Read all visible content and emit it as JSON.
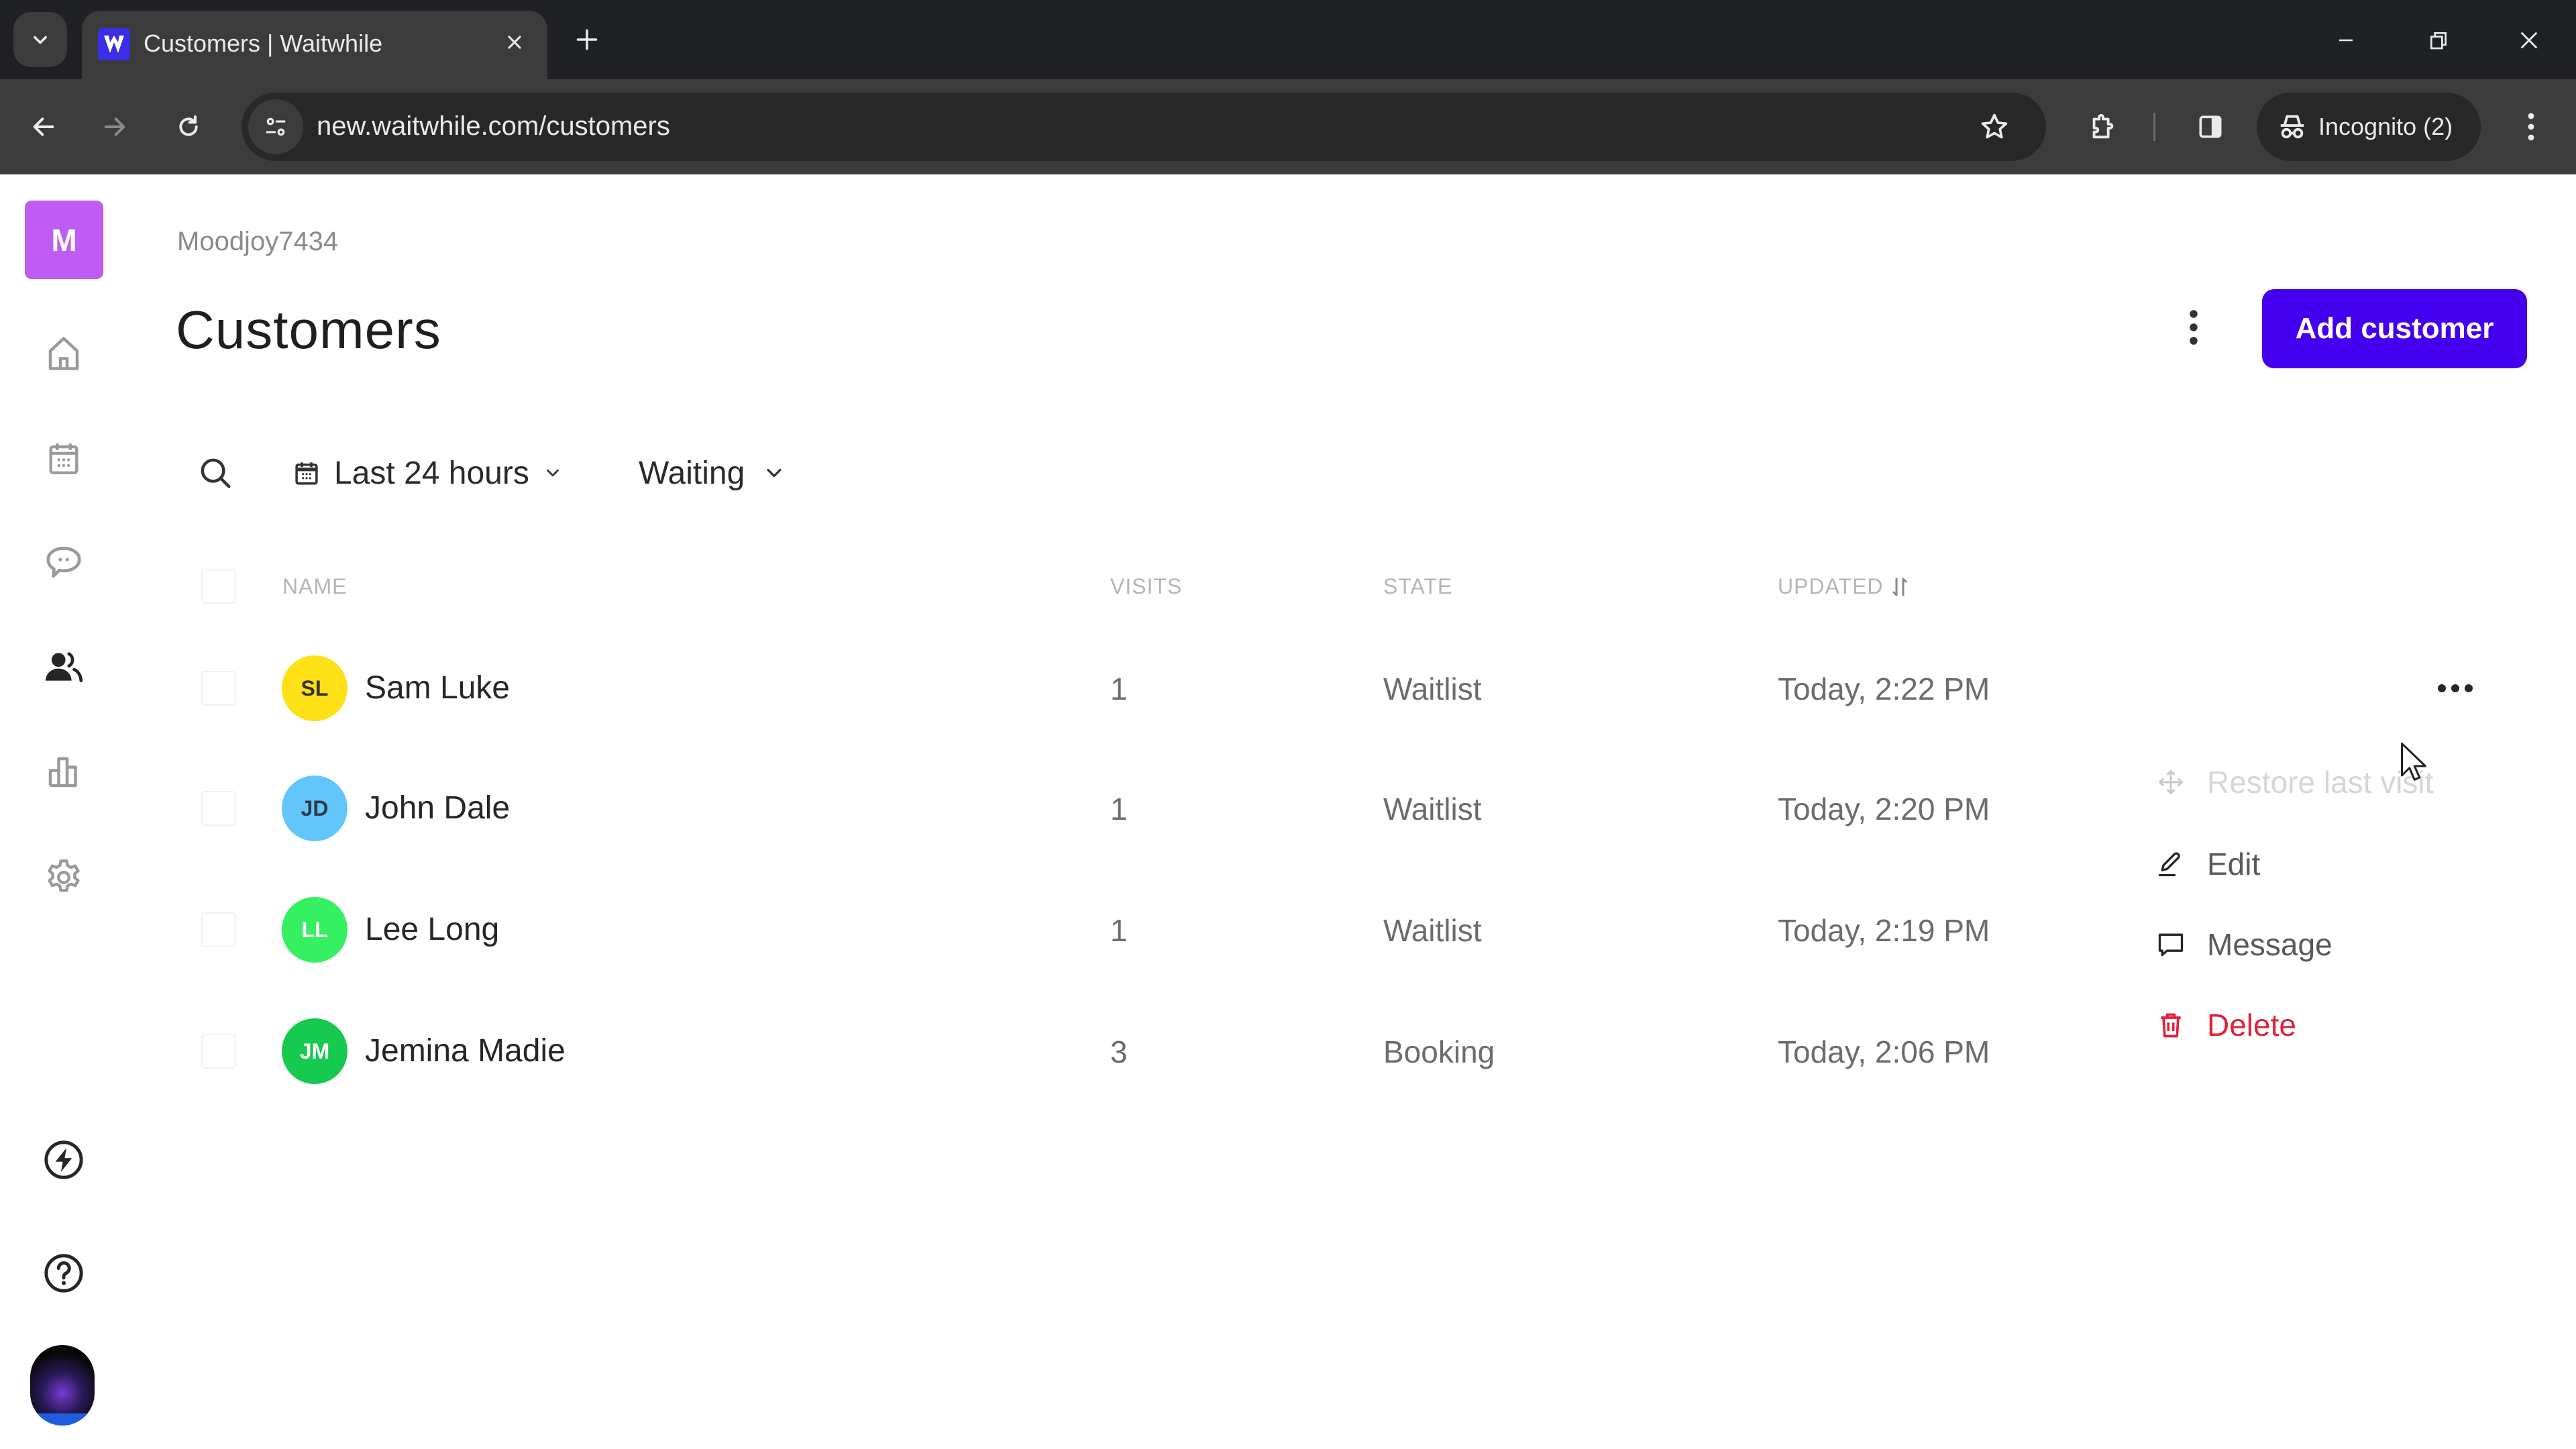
{
  "browser": {
    "tab_title": "Customers | Waitwhile",
    "favicon_letter": "W",
    "url": "new.waitwhile.com/customers",
    "incognito_label": "Incognito (2)",
    "icons": {
      "tab_search": "chevron-down-icon",
      "close_tab": "close-icon",
      "new_tab": "plus-icon",
      "minimize": "minimize-icon",
      "restore": "restore-window-icon",
      "close_window": "close-icon",
      "back": "arrow-left-icon",
      "forward": "arrow-right-icon",
      "reload": "reload-icon",
      "site_info": "tune-icon",
      "bookmark": "star-icon",
      "extensions": "puzzle-icon",
      "side_panel": "side-panel-icon",
      "incognito": "incognito-icon",
      "menu": "kebab-icon"
    }
  },
  "sidebar": {
    "org_initial": "M",
    "org_color": "#c05cf5",
    "items": [
      {
        "name": "home",
        "icon": "home-icon",
        "active": false
      },
      {
        "name": "calendar",
        "icon": "calendar-icon",
        "active": false
      },
      {
        "name": "messages",
        "icon": "chat-icon",
        "active": false
      },
      {
        "name": "customers",
        "icon": "users-icon",
        "active": true
      },
      {
        "name": "analytics",
        "icon": "bar-chart-icon",
        "active": false
      },
      {
        "name": "settings",
        "icon": "gear-icon",
        "active": false
      }
    ],
    "bottom_items": [
      {
        "name": "whats-new",
        "icon": "lightning-icon"
      },
      {
        "name": "help",
        "icon": "help-icon"
      },
      {
        "name": "profile",
        "icon": "user-avatar"
      }
    ]
  },
  "header": {
    "org_name": "Moodjoy7434",
    "title": "Customers",
    "add_button_label": "Add customer",
    "accent_color": "#4400ee"
  },
  "filters": {
    "date_range": "Last 24 hours",
    "state": "Waiting"
  },
  "table": {
    "columns": [
      "NAME",
      "VISITS",
      "STATE",
      "UPDATED"
    ],
    "sort_column": "UPDATED",
    "rows": [
      {
        "initials": "SL",
        "name": "Sam Luke",
        "visits": "1",
        "state": "Waitlist",
        "updated": "Today, 2:22 PM",
        "avatar_color": "#fde015",
        "initials_color": "#333333"
      },
      {
        "initials": "JD",
        "name": "John Dale",
        "visits": "1",
        "state": "Waitlist",
        "updated": "Today, 2:20 PM",
        "avatar_color": "#63c6fb",
        "initials_color": "#2b3a4a"
      },
      {
        "initials": "LL",
        "name": "Lee Long",
        "visits": "1",
        "state": "Waitlist",
        "updated": "Today, 2:19 PM",
        "avatar_color": "#35f060",
        "initials_color": "#ffffff"
      },
      {
        "initials": "JM",
        "name": "Jemina Madie",
        "visits": "3",
        "state": "Booking",
        "updated": "Today, 2:06 PM",
        "avatar_color": "#16c94f",
        "initials_color": "#ffffff"
      }
    ]
  },
  "row_menu": {
    "items": [
      {
        "label": "Restore last visit",
        "icon": "move-icon",
        "disabled": true
      },
      {
        "label": "Edit",
        "icon": "pencil-icon",
        "disabled": false
      },
      {
        "label": "Message",
        "icon": "message-icon",
        "disabled": false
      },
      {
        "label": "Delete",
        "icon": "trash-icon",
        "disabled": false,
        "danger": true
      }
    ],
    "danger_color": "#e0203a"
  }
}
